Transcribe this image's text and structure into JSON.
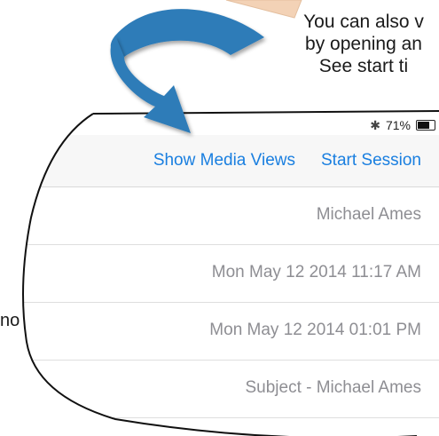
{
  "callout": {
    "lines": [
      "You can also v",
      "by opening an",
      "See start ti"
    ]
  },
  "side_text": "no",
  "status_bar": {
    "bluetooth_icon": "bluetooth-icon",
    "battery_percent": "71%",
    "battery_level": 0.71
  },
  "navbar": {
    "show_media_views": "Show Media Views",
    "start_session": "Start Session"
  },
  "rows": [
    "Michael Ames",
    "Mon May 12 2014 11:17 AM",
    "Mon May 12 2014 01:01 PM",
    "Subject - Michael Ames"
  ],
  "colors": {
    "accent": "#1a7fe0",
    "arrow": "#2e7bb8",
    "paper": "#f3d2b6"
  }
}
